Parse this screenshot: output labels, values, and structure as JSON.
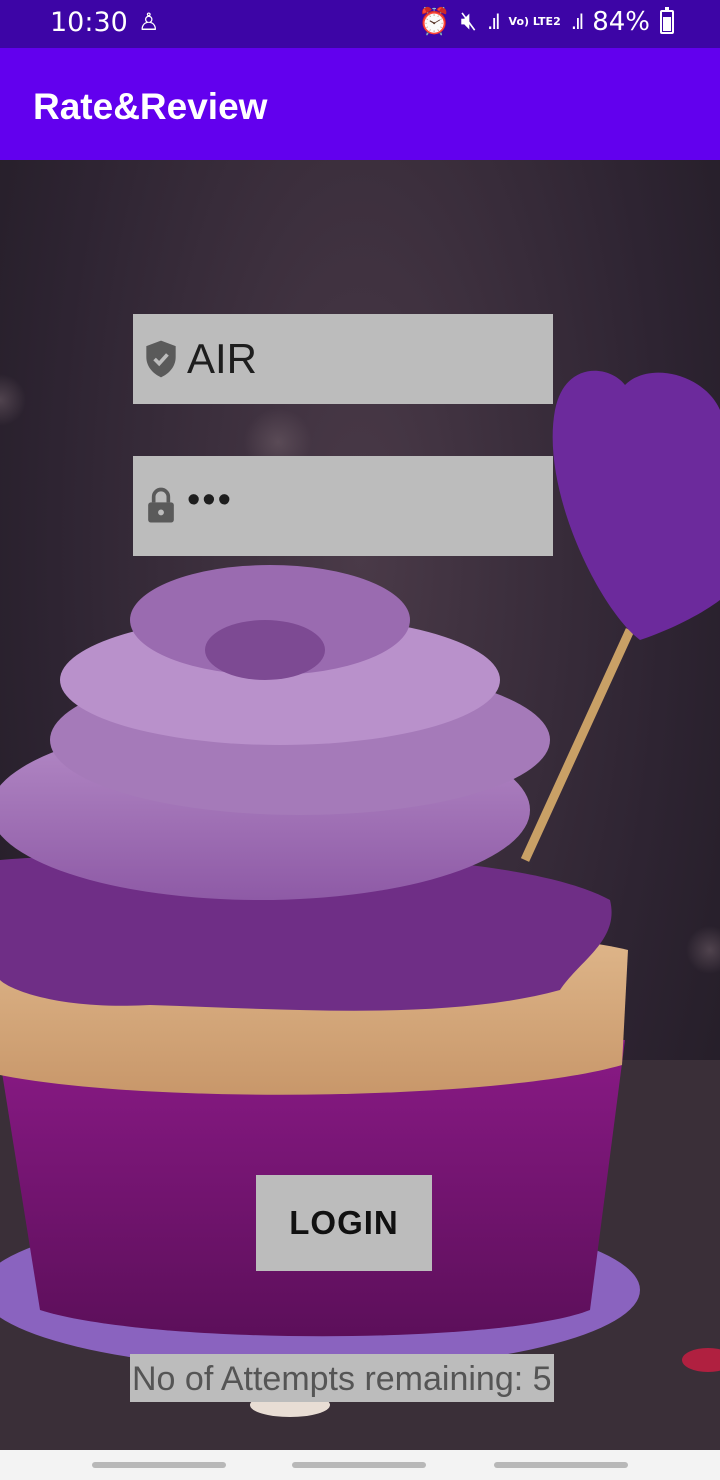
{
  "status_bar": {
    "time": "10:30",
    "battery_percent": "84%",
    "icons": [
      "person-icon",
      "alarm-icon",
      "mute-icon",
      "wifi-signal-icon",
      "volte-icon",
      "cell-signal-icon",
      "battery-icon"
    ],
    "volte_text": "Vo) LTE2"
  },
  "app_bar": {
    "title": "Rate&Review"
  },
  "form": {
    "username": {
      "value": "AIR",
      "icon": "shield-check-icon"
    },
    "password": {
      "value": "•••",
      "icon": "lock-icon"
    }
  },
  "login_button": {
    "label": "LOGIN"
  },
  "attempts_text": "No of Attempts remaining: 5",
  "colors": {
    "status_bar": "#3d05a6",
    "app_bar": "#6200ee",
    "field_bg": "#bcbcbc",
    "nav_bar": "#f3f3f3"
  }
}
